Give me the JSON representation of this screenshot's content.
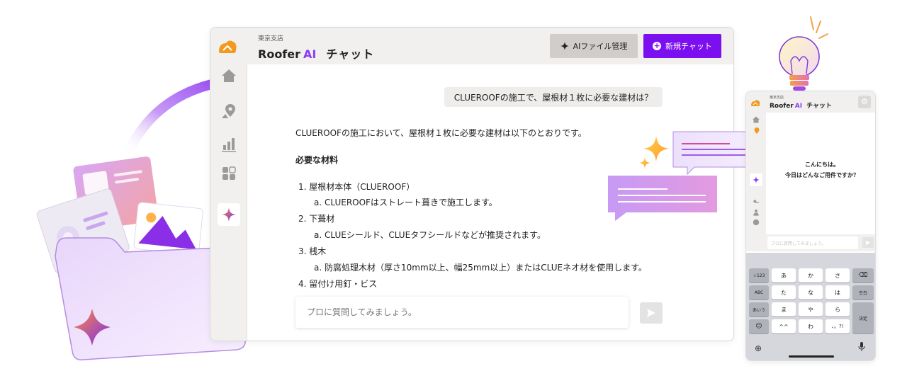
{
  "window": {
    "branch": "東京支店",
    "title_roofer": "Roofer",
    "title_ai": "AI",
    "title_chat": "チャット",
    "file_button": "AIファイル管理",
    "new_chat_button": "新規チャット"
  },
  "conversation": {
    "question": "CLUEROOFの施工で、屋根材１枚に必要な建材は？",
    "intro": "CLUEROOFの施工において、屋根材１枚に必要な建材は以下のとおりです。",
    "heading": "必要な材料",
    "items": [
      {
        "label": "1. 屋根材本体（CLUEROOF）",
        "detail": "a. CLUEROOFはストレート葺きで施工します。"
      },
      {
        "label": "2. 下葺材",
        "detail": "a. CLUEシールド、CLUEタフシールドなどが推奨されます。"
      },
      {
        "label": "3. 桟木",
        "detail": "a. 防腐処理木材（厚さ10mm以上、幅25mm以上）またはCLUEネオ材を使用します。"
      },
      {
        "label": "4. 留付け用釘・ビス"
      }
    ]
  },
  "input": {
    "placeholder": "プロに質問してみましょう。"
  },
  "phone": {
    "branch": "東京支店",
    "title_roofer": "Roofer",
    "title_ai": "AI",
    "title_chat": "チャット",
    "greeting_line1": "こんにちは。",
    "greeting_line2": "今日はどんなご用件ですか？",
    "input_placeholder": "プロに質問してみましょう。",
    "keyboard": {
      "row1": [
        "☆123",
        "あ",
        "か",
        "さ",
        "⌫"
      ],
      "row2": [
        "ABC",
        "た",
        "な",
        "は",
        "空白"
      ],
      "row3": [
        "あいう",
        "ま",
        "や",
        "ら",
        "決定"
      ],
      "row4": [
        "☺",
        "^^",
        "わ",
        "、。?!"
      ]
    }
  },
  "colors": {
    "accent_purple": "#7c0ff0",
    "ai_purple": "#8a3df2",
    "logo_orange": "#f39a1e",
    "panel_gray": "#f1f0ef"
  }
}
